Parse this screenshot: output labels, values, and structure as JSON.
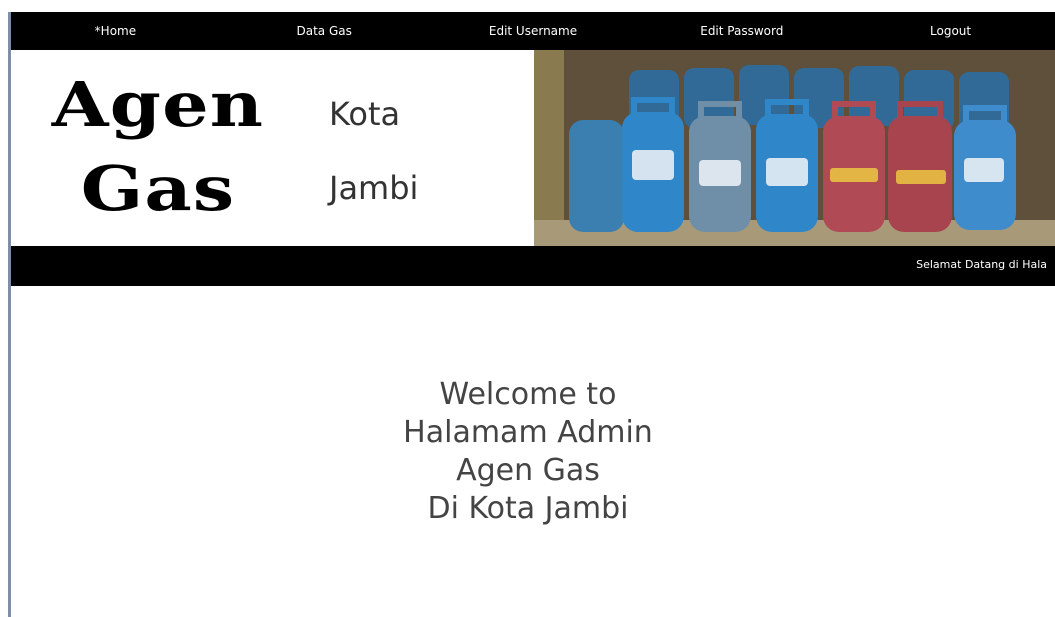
{
  "nav": {
    "items": [
      {
        "label": "*Home"
      },
      {
        "label": "Data Gas"
      },
      {
        "label": "Edit Username"
      },
      {
        "label": "Edit Password"
      },
      {
        "label": "Logout"
      }
    ]
  },
  "header": {
    "logo_line1": "Agen",
    "logo_line2": "Gas",
    "city_line1": "Kota",
    "city_line2": "Jambi",
    "photo": "lpg-gas-cylinders-photo"
  },
  "ticker": {
    "text": "Selamat Datang di Hala"
  },
  "welcome": {
    "lines": [
      "Welcome to",
      "Halamam Admin",
      "Agen Gas",
      "Di Kota Jambi"
    ]
  },
  "colors": {
    "nav_bg": "#000000",
    "nav_text": "#ffffff",
    "cylinder_blue": "#2f86c8",
    "cylinder_red": "#b04a55",
    "body_text": "#444444"
  }
}
